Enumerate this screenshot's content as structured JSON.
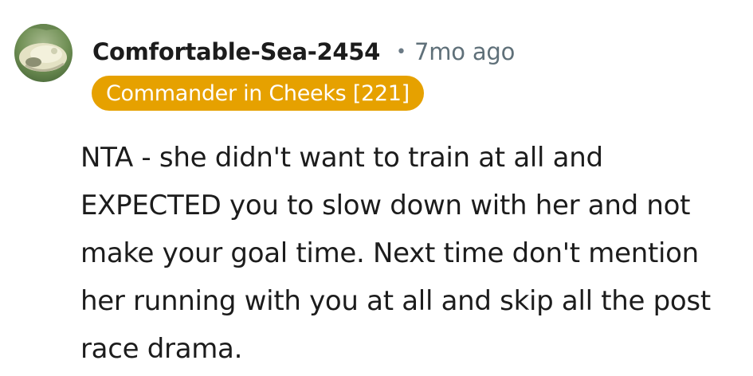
{
  "comment": {
    "author": "Comfortable-Sea-2454",
    "separator": "•",
    "timestamp": "7mo ago",
    "flair": "Commander in Cheeks [221]",
    "body": "NTA - she didn't want to train at all and EXPECTED you to slow down with her and not make your goal time. Next time don't mention her running with you at all and skip all the post race drama."
  },
  "colors": {
    "flair_background": "#e6a100",
    "username": "#1c1c1c",
    "timestamp": "#5f7079",
    "body_text": "#1c1c1c"
  },
  "icons": {
    "avatar": "user-avatar-image"
  }
}
